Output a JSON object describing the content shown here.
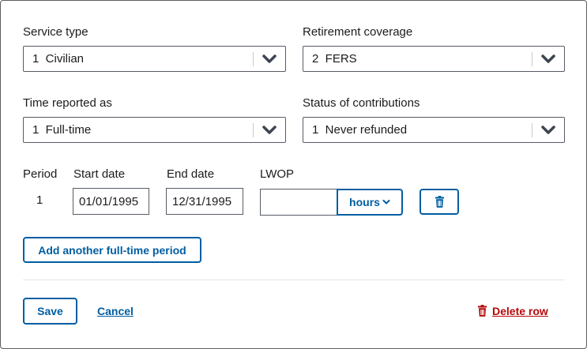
{
  "service_type": {
    "label": "Service type",
    "value": "1  Civilian"
  },
  "retirement_coverage": {
    "label": "Retirement coverage",
    "value": "2  FERS"
  },
  "time_reported_as": {
    "label": "Time reported as",
    "value": "1  Full-time"
  },
  "status_of_contributions": {
    "label": "Status of contributions",
    "value": "1  Never refunded"
  },
  "period_table": {
    "headers": {
      "period": "Period",
      "start_date": "Start date",
      "end_date": "End date",
      "lwop": "LWOP"
    },
    "rows": [
      {
        "period": "1",
        "start_date": "01/01/1995",
        "end_date": "12/31/1995",
        "lwop": "",
        "lwop_unit": "hours"
      }
    ]
  },
  "actions": {
    "add_period": "Add another full-time period",
    "save": "Save",
    "cancel": "Cancel",
    "delete_row": "Delete row"
  },
  "colors": {
    "primary": "#005ea2",
    "danger": "#b50909",
    "border": "#565c65"
  },
  "icons": {
    "select_chevron": "chevron-down-icon",
    "row_delete": "trash-icon",
    "unit_chevron": "chevron-down-icon"
  }
}
